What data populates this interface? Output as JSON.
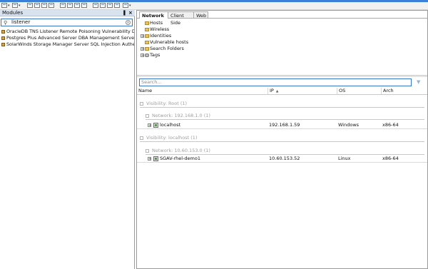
{
  "toolbar": {
    "icons": [
      "toolbar-icon-1",
      "toolbar-icon-2",
      "toolbar-icon-3",
      "toolbar-icon-4",
      "toolbar-icon-5",
      "toolbar-icon-6",
      "toolbar-icon-7",
      "toolbar-icon-8",
      "toolbar-icon-9",
      "toolbar-icon-10"
    ],
    "accent": "#3b80d8"
  },
  "modules_panel": {
    "title": "Modules",
    "pin_glyph": "▐",
    "close_glyph": "×",
    "search": {
      "value": "listener",
      "clear_glyph": "×"
    },
    "results": [
      "OracleDB TNS Listener Remote Poisoning Vulnerability Detector",
      "Postgres Plus Advanced Server DBA Management Server Remote",
      "SolarWinds Storage Manager Server SQL Injection Authentication"
    ]
  },
  "workspace": {
    "tabs": [
      "Network",
      "Client Side",
      "Web"
    ],
    "active_tab": "Network",
    "tree": [
      {
        "label": "Hosts",
        "expander": ""
      },
      {
        "label": "Wireless",
        "expander": ""
      },
      {
        "label": "Identities",
        "expander": "+"
      },
      {
        "label": "Vulnerable hosts",
        "expander": ""
      },
      {
        "label": "Search Folders",
        "expander": "+"
      },
      {
        "label": "Tags",
        "expander": "+"
      }
    ],
    "search_placeholder": "Search...",
    "columns": {
      "name": "Name",
      "ip": "IP",
      "os": "OS",
      "arch": "Arch"
    },
    "groups": [
      {
        "visibility": "Visibility: Root (1)",
        "network": "Network: 192.168.1.0 (1)",
        "host": {
          "name": "localhost",
          "ip": "192.168.1.59",
          "os": "Windows",
          "arch": "x86-64"
        }
      },
      {
        "visibility": "Visibility: localhost (1)",
        "network": "Network: 10.60.153.0 (1)",
        "host": {
          "name": "SGAV-rhel-demo1",
          "ip": "10.60.153.52",
          "os": "Linux",
          "arch": "x86-64"
        }
      }
    ]
  }
}
